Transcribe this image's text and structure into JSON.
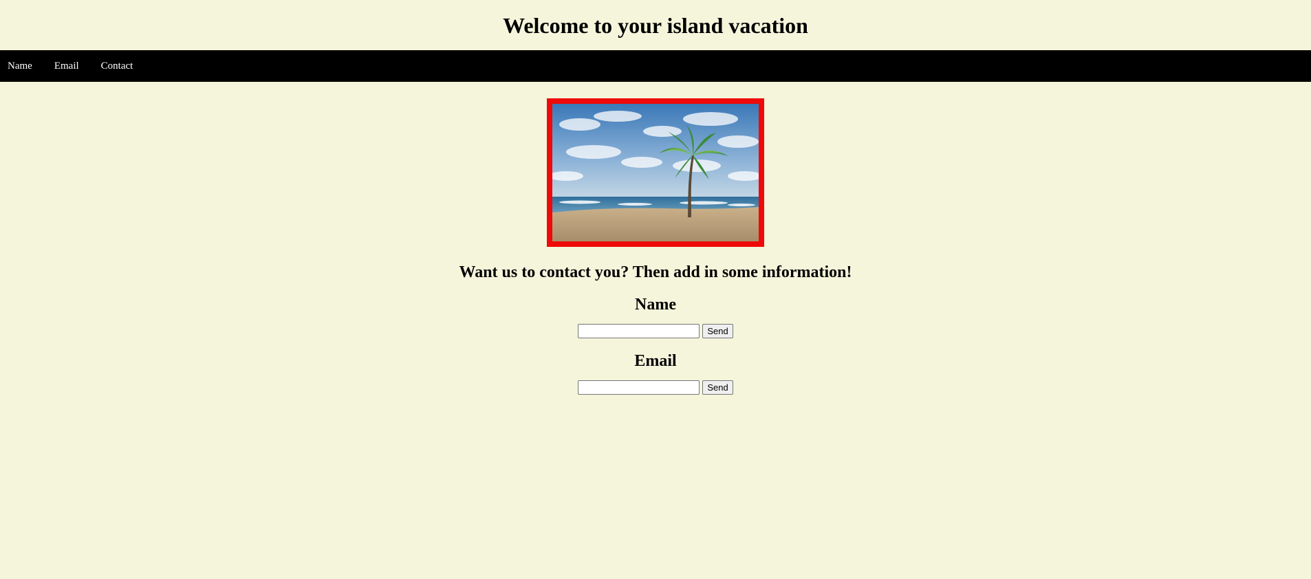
{
  "header": {
    "title": "Welcome to your island vacation"
  },
  "nav": {
    "items": [
      {
        "label": "Name"
      },
      {
        "label": "Email"
      },
      {
        "label": "Contact"
      }
    ]
  },
  "hero": {
    "image": "beach-palm-tree-photo",
    "border_color": "#ef0a0a"
  },
  "contact": {
    "heading": "Want us to contact you? Then add in some information!",
    "name_section": {
      "title": "Name",
      "input_value": "",
      "button_label": "Send"
    },
    "email_section": {
      "title": "Email",
      "input_value": "",
      "button_label": "Send"
    }
  },
  "colors": {
    "background": "#f5f5dc",
    "navbar": "#000000",
    "nav_text": "#ffffff"
  }
}
